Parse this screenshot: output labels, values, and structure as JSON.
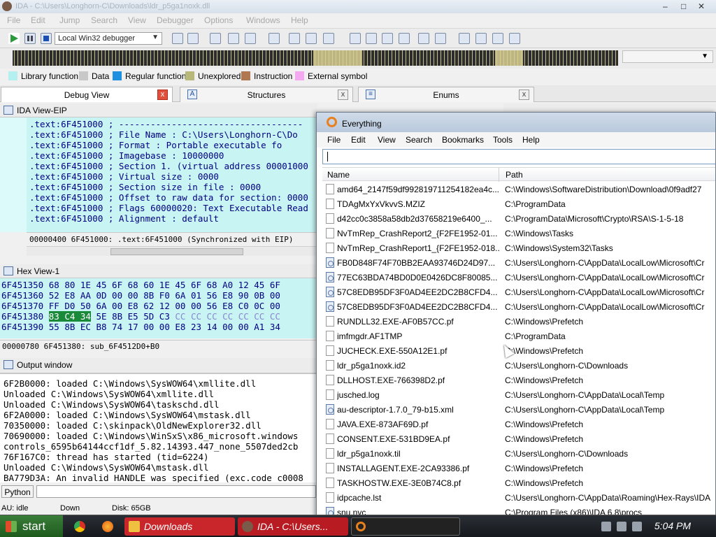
{
  "ida": {
    "title": "IDA - C:\\Users\\Longhorn-C\\Downloads\\ldr_p5ga1noxk.dll",
    "menu": [
      "File",
      "Edit",
      "Jump",
      "Search",
      "View",
      "Debugger",
      "Options",
      "Windows",
      "Help"
    ],
    "debugger_select": "Local Win32 debugger",
    "legend": [
      {
        "label": "Library function",
        "color": "#b4f0f0"
      },
      {
        "label": "Data",
        "color": "#c8c8c8"
      },
      {
        "label": "Regular function",
        "color": "#1e90e0"
      },
      {
        "label": "Unexplored",
        "color": "#b8b87a"
      },
      {
        "label": "Instruction",
        "color": "#b07850"
      },
      {
        "label": "External symbol",
        "color": "#f4a8f0"
      }
    ],
    "tabs": [
      {
        "label": "Debug View",
        "close": "x"
      },
      {
        "label": "Structures",
        "close": "x"
      },
      {
        "label": "Enums",
        "close": "x"
      }
    ],
    "ida_view": {
      "title": "IDA View-EIP",
      "lines": [
        ".text:6F451000 ; -----------------------------------",
        ".text:6F451000 ; File Name   : C:\\Users\\Longhorn-C\\Do",
        ".text:6F451000 ; Format      : Portable executable fo",
        ".text:6F451000 ; Imagebase   : 10000000",
        ".text:6F451000 ; Section 1. (virtual address 00001000",
        ".text:6F451000 ; Virtual size              : 0000",
        ".text:6F451000 ; Section size in file      : 0000",
        ".text:6F451000 ; Offset to raw data for section: 0000",
        ".text:6F451000 ; Flags 60000020: Text Executable Read",
        ".text:6F451000 ; Alignment     : default"
      ],
      "status": "00000400 6F451000: .text:6F451000 (Synchronized with EIP)"
    },
    "hex_view": {
      "title": "Hex View-1",
      "rows": [
        {
          "addr": "6F451350",
          "bytes": "68 80 1E 45 6F 68 60 1E  45 6F 68 A0 12 45 6F"
        },
        {
          "addr": "6F451360",
          "bytes": "52 E8 AA 0D 00 00 8B F0  6A 01 56 E8 90 0B 00"
        },
        {
          "addr": "6F451370",
          "bytes": "FF D0 50 6A 00 E8 62 12  00 00 56 E8 C0 0C 00"
        },
        {
          "addr": "6F451380",
          "sel": "83 C4 34",
          "bytes": " 5E 8B E5 5D C3 ",
          "gray": "CC CC CC CC CC CC CC"
        },
        {
          "addr": "6F451390",
          "bytes": "55 8B EC B8 74 17 00 00  E8 23 14 00 00 A1 34"
        }
      ],
      "status": "00000780 6F451380: sub_6F4512D0+B0"
    },
    "output": {
      "title": "Output window",
      "lines": [
        "6F2B0000: loaded C:\\Windows\\SysWOW64\\xmllite.dll",
        "Unloaded C:\\Windows\\SysWOW64\\xmllite.dll",
        "Unloaded C:\\Windows\\SysWOW64\\taskschd.dll",
        "6F2A0000: loaded C:\\Windows\\SysWOW64\\mstask.dll",
        "70350000: loaded C:\\skinpack\\OldNewExplorer32.dll",
        "70690000: loaded C:\\Windows\\WinSxS\\x86_microsoft.windows",
        "controls_6595b64144ccf1df_5.82.14393.447_none_5507ded2cb",
        "76F167C0: thread has started (tid=6224)",
        "Unloaded C:\\Windows\\SysWOW64\\mstask.dll",
        "BA779D3A: An invalid HANDLE was specified (exc.code c0008"
      ],
      "python_btn": "Python"
    },
    "statusbar": {
      "state": "AU:  idle",
      "direction": "Down",
      "disk": "Disk: 65GB"
    }
  },
  "everything": {
    "title": "Everything",
    "menu": [
      "File",
      "Edit",
      "View",
      "Search",
      "Bookmarks",
      "Tools",
      "Help"
    ],
    "search_value": "",
    "columns": {
      "name": "Name",
      "path": "Path"
    },
    "rows": [
      {
        "name": "amd64_2147f59df992819711254182ea4c...",
        "path": "C:\\Windows\\SoftwareDistribution\\Download\\0f9adf27",
        "icon": "file"
      },
      {
        "name": "TDAgMxYxVkvvS.MZIZ",
        "path": "C:\\ProgramData",
        "icon": "file"
      },
      {
        "name": "d42cc0c3858a58db2d37658219e6400_...",
        "path": "C:\\ProgramData\\Microsoft\\Crypto\\RSA\\S-1-5-18",
        "icon": "file"
      },
      {
        "name": "NvTmRep_CrashReport2_{F2FE1952-01...",
        "path": "C:\\Windows\\Tasks",
        "icon": "file"
      },
      {
        "name": "NvTmRep_CrashReport1_{F2FE1952-018...",
        "path": "C:\\Windows\\System32\\Tasks",
        "icon": "file"
      },
      {
        "name": "FB0D848F74F70BB2EAA93746D24D97...",
        "path": "C:\\Users\\Longhorn-C\\AppData\\LocalLow\\Microsoft\\Cr",
        "icon": "gear"
      },
      {
        "name": "77EC63BDA74BD0D0E0426DC8F80085...",
        "path": "C:\\Users\\Longhorn-C\\AppData\\LocalLow\\Microsoft\\Cr",
        "icon": "gear"
      },
      {
        "name": "57C8EDB95DF3F0AD4EE2DC2B8CFD4...",
        "path": "C:\\Users\\Longhorn-C\\AppData\\LocalLow\\Microsoft\\Cr",
        "icon": "gear"
      },
      {
        "name": "57C8EDB95DF3F0AD4EE2DC2B8CFD4...",
        "path": "C:\\Users\\Longhorn-C\\AppData\\LocalLow\\Microsoft\\Cr",
        "icon": "gear"
      },
      {
        "name": "RUNDLL32.EXE-AF0B57CC.pf",
        "path": "C:\\Windows\\Prefetch",
        "icon": "file"
      },
      {
        "name": "imfmgdr.AF1TMP",
        "path": "C:\\ProgramData",
        "icon": "file"
      },
      {
        "name": "JUCHECK.EXE-550A12E1.pf",
        "path": "C:\\Windows\\Prefetch",
        "icon": "file"
      },
      {
        "name": "ldr_p5ga1noxk.id2",
        "path": "C:\\Users\\Longhorn-C\\Downloads",
        "icon": "file"
      },
      {
        "name": "DLLHOST.EXE-766398D2.pf",
        "path": "C:\\Windows\\Prefetch",
        "icon": "file"
      },
      {
        "name": "jusched.log",
        "path": "C:\\Users\\Longhorn-C\\AppData\\Local\\Temp",
        "icon": "file"
      },
      {
        "name": "au-descriptor-1.7.0_79-b15.xml",
        "path": "C:\\Users\\Longhorn-C\\AppData\\Local\\Temp",
        "icon": "gear"
      },
      {
        "name": "JAVA.EXE-873AF69D.pf",
        "path": "C:\\Windows\\Prefetch",
        "icon": "file"
      },
      {
        "name": "CONSENT.EXE-531BD9EA.pf",
        "path": "C:\\Windows\\Prefetch",
        "icon": "file"
      },
      {
        "name": "ldr_p5ga1noxk.til",
        "path": "C:\\Users\\Longhorn-C\\Downloads",
        "icon": "file"
      },
      {
        "name": "INSTALLAGENT.EXE-2CA93386.pf",
        "path": "C:\\Windows\\Prefetch",
        "icon": "file"
      },
      {
        "name": "TASKHOSTW.EXE-3E0B74C8.pf",
        "path": "C:\\Windows\\Prefetch",
        "icon": "file"
      },
      {
        "name": "idpcache.lst",
        "path": "C:\\Users\\Longhorn-C\\AppData\\Roaming\\Hex-Rays\\IDA",
        "icon": "file"
      },
      {
        "name": "snu.nvc",
        "path": "C:\\Program Files (x86)\\IDA 6.8\\procs",
        "icon": "gear"
      }
    ]
  },
  "taskbar": {
    "start": "start",
    "items": [
      "Downloads",
      "IDA - C:\\Users..."
    ],
    "clock": "5:04 PM"
  }
}
